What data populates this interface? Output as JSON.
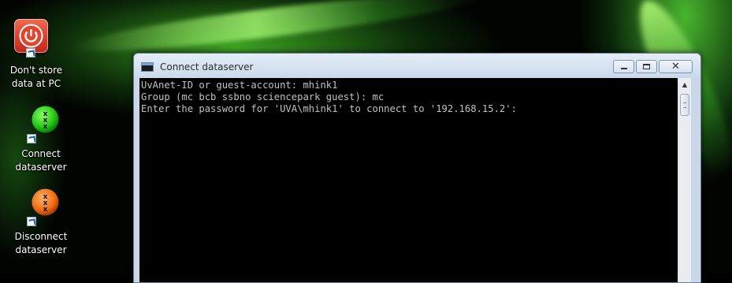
{
  "desktop": {
    "icons": [
      {
        "label": "Don't store data at PC",
        "icon": "power-icon",
        "color": "#d83a24"
      },
      {
        "label": "Connect dataserver",
        "icon": "green-x-orb-icon",
        "color": "#2bd11e"
      },
      {
        "label": "Disconnect dataserver",
        "icon": "orange-x-orb-icon",
        "color": "#f26b13"
      }
    ]
  },
  "window": {
    "title": "Connect dataserver",
    "controls": {
      "close_glyph": "✕"
    },
    "console_lines": [
      "UvAnet-ID or guest-account: mhink1",
      "Group (mc bcb ssbno sciencepark guest): mc",
      "Enter the password for 'UVA\\mhink1' to connect to '192.168.15.2':"
    ]
  }
}
